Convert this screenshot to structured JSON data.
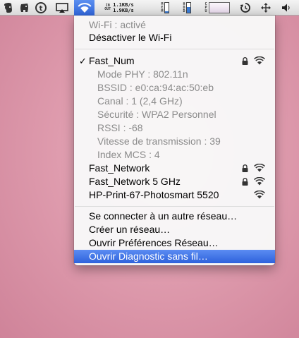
{
  "menubar": {
    "icons": [
      "evernote-icon",
      "elephant-icon",
      "timemachine-icon",
      "airplay-icon",
      "wifi-icon",
      "network-activity-icon",
      "memory-icon",
      "disk-icon",
      "cpu-icon",
      "sync-icon",
      "move-icon",
      "volume-icon"
    ],
    "network": {
      "in_label": "IN",
      "out_label": "OUT",
      "upload": "1.1KB/s",
      "download": "1.9KB/s"
    },
    "mem_label": "MEM",
    "hdd_label": "HDD",
    "cpu_label": "CPU",
    "mem_fill": 0.12,
    "hdd_fill": 0.55
  },
  "wifi_menu": {
    "status": "Wi-Fi : activé",
    "toggle": "Désactiver le Wi-Fi",
    "current_network": {
      "name": "Fast_Num",
      "checked": true,
      "details": [
        "Mode PHY : 802.11n",
        "BSSID : e0:ca:94:ac:50:eb",
        "Canal : 1 (2,4 GHz)",
        "Sécurité : WPA2 Personnel",
        "RSSI : -68",
        "Vitesse de transmission : 39",
        "Index MCS : 4"
      ]
    },
    "networks": [
      {
        "name": "Fast_Network",
        "locked": true
      },
      {
        "name": "Fast_Network 5 GHz",
        "locked": true
      },
      {
        "name": "HP-Print-67-Photosmart 5520",
        "locked": false
      }
    ],
    "actions": [
      "Se connecter à un autre réseau…",
      "Créer un réseau…",
      "Ouvrir Préférences Réseau…",
      "Ouvrir Diagnostic sans fil…"
    ],
    "highlight_color": "#3a6fe0"
  }
}
